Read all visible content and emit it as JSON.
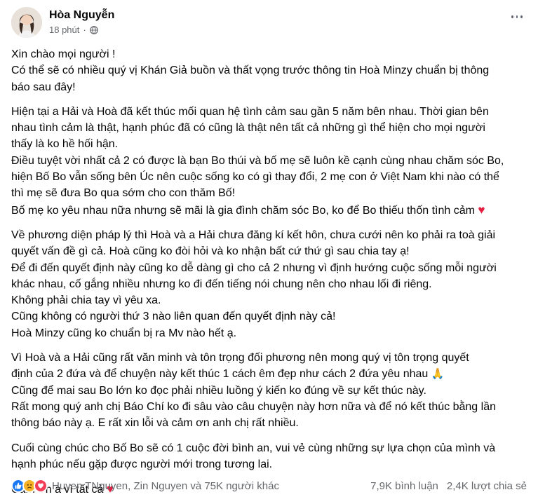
{
  "post": {
    "author": "Hòa Nguyễn",
    "time": "18 phút",
    "dot": "·",
    "paragraphs": [
      [
        "Xin chào mọi người !",
        "Có thể sẽ có nhiều quý vị Khán Giả buồn và thất vọng trước thông tin Hoà Minzy chuẩn bị thông",
        "báo sau đây!"
      ],
      [
        "Hiện tại a Hải và Hoà đã kết thúc mối quan hệ tình cảm sau gần 5 năm bên nhau. Thời gian bên",
        "nhau tình cảm là thật, hạnh phúc đã có cũng là thật nên tất cả những gì thể hiện cho mọi người",
        "thấy là ko hề hối hận.",
        "Điều tuyệt vời nhất cả 2 có được là bạn Bo thúi và bố mẹ sẽ luôn kề cạnh cùng nhau chăm sóc Bo,",
        "hiện Bố Bo vẫn sống bên Úc nên cuộc sống ko có gì thay đổi, 2 mẹ con ở Việt Nam khi nào có thể",
        "thì mẹ sẽ đưa Bo qua sớm cho con thăm Bố!",
        "Bố mẹ ko yêu nhau nữa nhưng sẽ mãi là gia đình chăm sóc Bo, ko để Bo thiếu thốn tình cảm"
      ],
      [
        "Về phương diện pháp lý thì Hoà và a Hải chưa đăng kí kết hôn, chưa cưới nên ko phải ra toà giải",
        "quyết vấn đề gì cả. Hoà cũng ko đòi hỏi và ko nhận bất cứ thứ gì sau chia tay ạ!",
        "Để đi đến quyết định này cũng ko dễ dàng gì cho cả 2 nhưng vì định hướng cuộc sống mỗi người",
        "khác nhau, cố gắng nhiều nhưng ko đi đến tiếng nói chung nên cho nhau lối đi riêng.",
        "Không phải chia tay vì yêu xa.",
        "Cũng không có người thứ 3 nào liên quan đến quyết định này cả!",
        "Hoà Minzy cũng ko chuẩn bị ra Mv nào hết ạ."
      ],
      [
        "Vì Hoà và a Hải cũng rất văn minh và tôn trọng đối phương nên mong quý vị tôn trọng quyết",
        "định của 2 đứa và để chuyện này kết thúc 1 cách êm đẹp như cách 2 đứa yêu nhau",
        "Cũng để mai sau Bo lớn ko đọc phải nhiều luồng ý kiến ko đúng về sự kết thúc này.",
        "Rất mong quý anh chị Báo Chí ko đi sâu vào câu chuyện này hơn nữa và để nó kết thúc bằng lần",
        "thông báo này ạ. E rất xin lỗi và cảm ơn anh chị rất nhiều."
      ],
      [
        "Cuối cùng chúc cho Bố Bo sẽ có 1 cuộc đời bình an, vui vẻ cùng những sự lựa chọn của mình và",
        "hạnh phúc nếu gặp được người mới trong tương lai."
      ],
      [
        "Cảm ơn a vì tất cả"
      ]
    ],
    "heart_emoji": "♥",
    "pray_emoji": "🙏"
  },
  "footer": {
    "reactions": "Huyen TNguyen, Zin Nguyen và 75K người khác",
    "comments": "7,9K bình luận",
    "shares": "2,4K lượt chia sẻ"
  },
  "icons": {
    "like": "like-icon",
    "sad": "sad-icon",
    "love": "love-icon",
    "globe": "globe-icon",
    "more": "more-icon"
  },
  "colors": {
    "text": "#050505",
    "secondary": "#65676b",
    "like": "#1877f2",
    "love": "#f33e58",
    "sad": "#f7b125",
    "heart": "#e41e3f"
  }
}
